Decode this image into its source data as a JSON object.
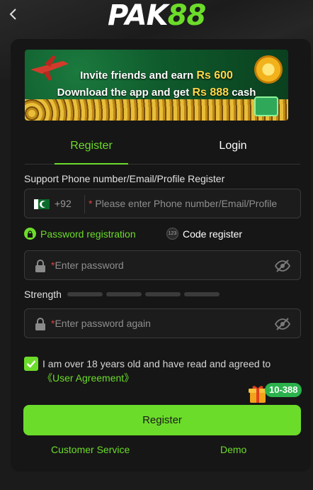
{
  "header": {
    "logo_pak": "PAK",
    "logo_num": "88",
    "back_icon": "chevron-left-icon"
  },
  "banner": {
    "line1_prefix": "Invite friends and earn ",
    "line1_amount": "Rs 600",
    "line2_prefix": "Download the app and get ",
    "line2_amount": "Rs 888",
    "line2_suffix": " cash"
  },
  "tabs": [
    {
      "label": "Register",
      "active": true
    },
    {
      "label": "Login",
      "active": false
    }
  ],
  "form": {
    "account_label": "Support Phone number/Email/Profile Register",
    "country_code": "+92",
    "account_placeholder": "Please enter Phone number/Email/Profile",
    "password_registration": "Password registration",
    "code_register": "Code register",
    "code_icon_text": "123",
    "password_placeholder": "Enter password",
    "strength_label": "Strength",
    "password_again_placeholder": "Enter password again",
    "required_mark": "*"
  },
  "agreement": {
    "checked": true,
    "text": "I am over 18 years old and have read and agreed to",
    "link": "《User Agreement》"
  },
  "promo_badge": "10-388",
  "register_button": "Register",
  "footer": {
    "customer_service": "Customer Service",
    "demo": "Demo"
  },
  "colors": {
    "accent": "#6cdc2a",
    "background": "#1b1b1c",
    "card": "#161616",
    "required": "#e0413e"
  }
}
